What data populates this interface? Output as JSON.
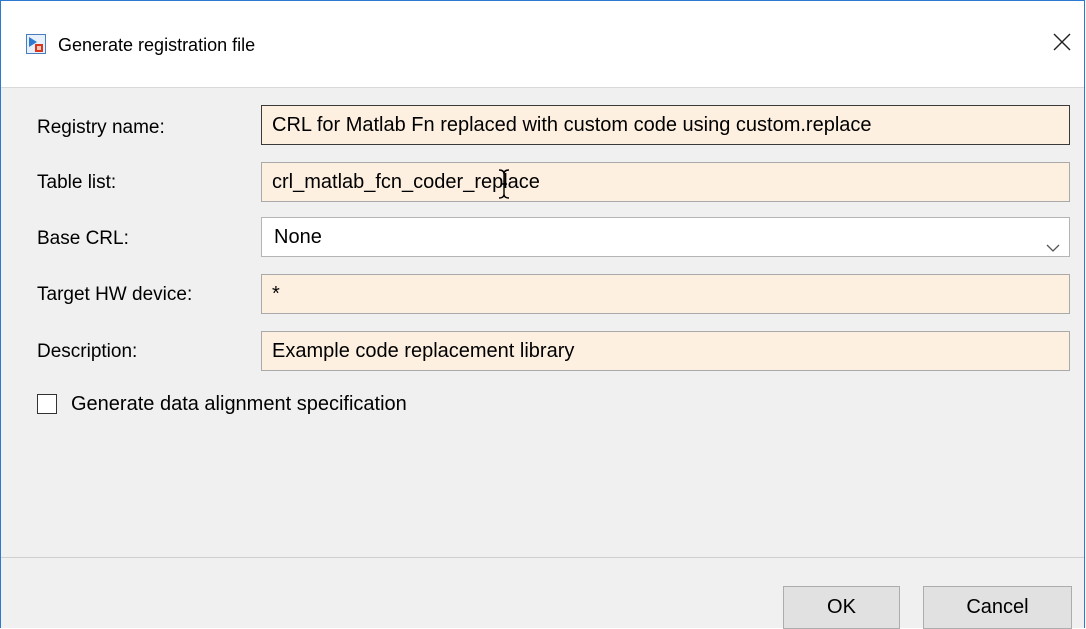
{
  "window": {
    "title": "Generate registration file",
    "icon": "simulink-model-icon",
    "close_icon": "close-icon"
  },
  "form": {
    "registry_name": {
      "label": "Registry name:",
      "value": "CRL for Matlab Fn replaced with custom code using custom.replace"
    },
    "table_list": {
      "label": "Table list:",
      "value": "crl_matlab_fcn_coder_replace"
    },
    "base_crl": {
      "label": "Base CRL:",
      "value": "None"
    },
    "target_hw": {
      "label": "Target HW device:",
      "value": "*"
    },
    "description": {
      "label": "Description:",
      "value": "Example code replacement library"
    },
    "data_alignment": {
      "label": "Generate data alignment specification",
      "checked": false
    }
  },
  "buttons": {
    "ok": "OK",
    "cancel": "Cancel"
  },
  "colors": {
    "field_bg": "#fdf0e0",
    "panel_bg": "#f0f0f0",
    "window_border": "#2b79d0"
  }
}
